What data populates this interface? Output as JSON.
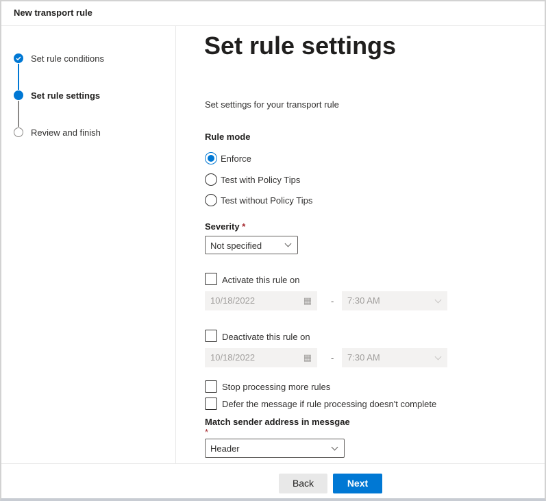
{
  "window": {
    "title": "New transport rule"
  },
  "steps": [
    {
      "label": "Set rule conditions",
      "state": "completed"
    },
    {
      "label": "Set rule settings",
      "state": "current"
    },
    {
      "label": "Review and finish",
      "state": "pending"
    }
  ],
  "main": {
    "title": "Set rule settings",
    "description": "Set settings for your transport rule",
    "rule_mode": {
      "label": "Rule mode",
      "options": [
        "Enforce",
        "Test with Policy Tips",
        "Test without Policy Tips"
      ],
      "selected": "Enforce"
    },
    "severity": {
      "label": "Severity",
      "required": "*",
      "value": "Not specified"
    },
    "activate": {
      "label": "Activate this rule on",
      "checked": false,
      "date": "10/18/2022",
      "separator": "-",
      "time": "7:30 AM"
    },
    "deactivate": {
      "label": "Deactivate this rule on",
      "checked": false,
      "date": "10/18/2022",
      "separator": "-",
      "time": "7:30 AM"
    },
    "stop_processing": {
      "label": "Stop processing more rules",
      "checked": false
    },
    "defer": {
      "label": "Defer the message if rule processing doesn't complete",
      "checked": false
    },
    "match_sender": {
      "label": "Match sender address in messgae",
      "required": "*",
      "value": "Header"
    }
  },
  "footer": {
    "back": "Back",
    "next": "Next"
  },
  "colors": {
    "accent": "#0078d4",
    "required": "#a4262c"
  }
}
